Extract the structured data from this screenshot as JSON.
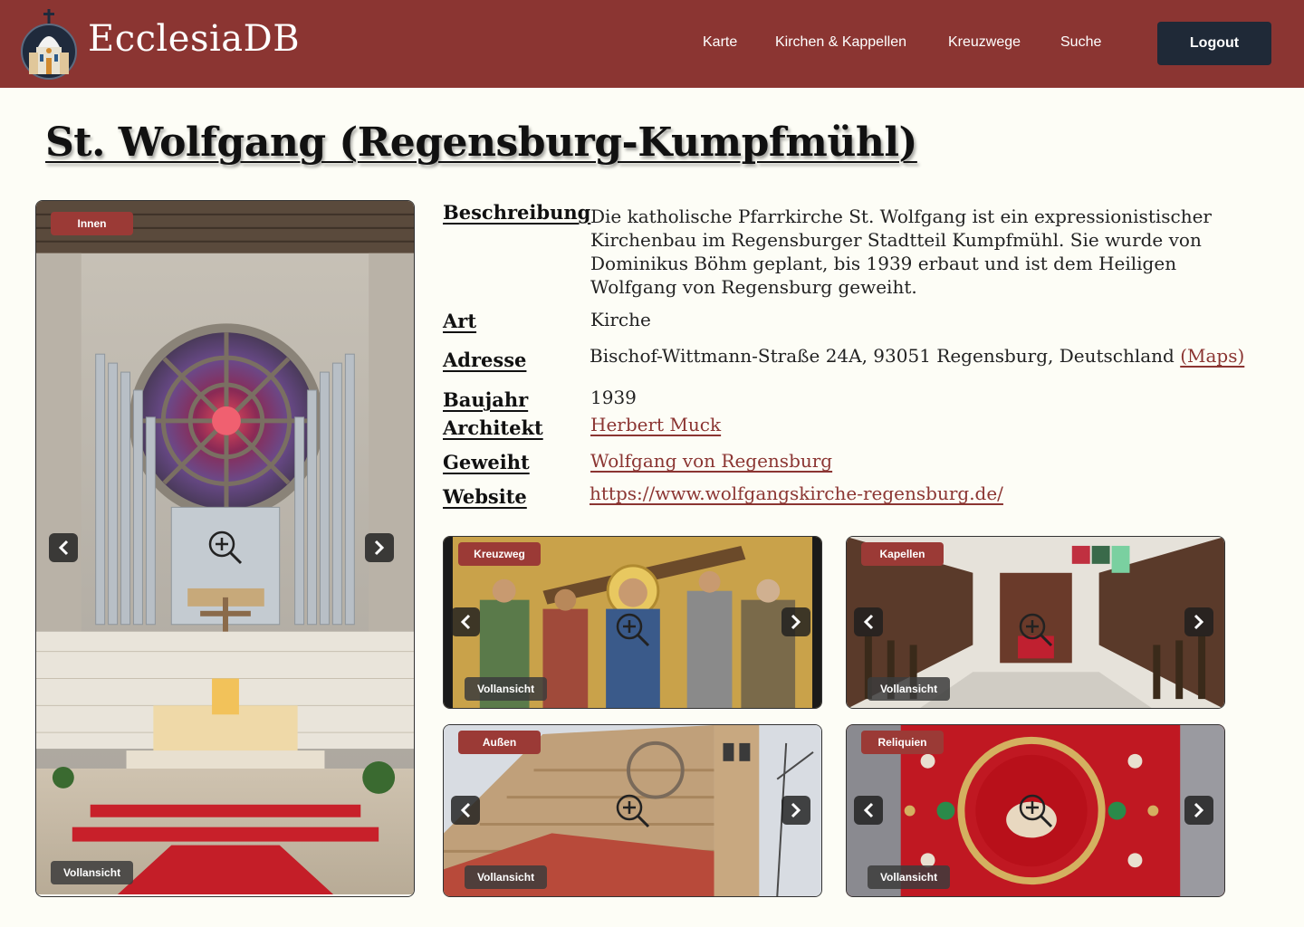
{
  "header": {
    "brand": "EcclesiaDB",
    "nav": [
      "Karte",
      "Kirchen & Kappellen",
      "Kreuzwege",
      "Suche"
    ],
    "logout_label": "Logout",
    "colors": {
      "header_bg": "#8b3532",
      "logout_bg": "#1f2937"
    }
  },
  "page": {
    "title": "St. Wolfgang (Regensburg-Kumpfmühl)"
  },
  "info": {
    "description_label": "Beschreibung",
    "description": "Die katholische Pfarrkirche St. Wolfgang ist ein expressionistischer Kirchenbau im Regensburger Stadtteil Kumpfmühl. Sie wurde von Dominikus Böhm geplant, bis 1939 erbaut und ist dem Heiligen Wolfgang von Regensburg geweiht.",
    "type_label": "Art",
    "type": "Kirche",
    "address_label": "Adresse",
    "address": "Bischof-Wittmann-Straße 24A, 93051 Regensburg, Deutschland",
    "maps_link": "(Maps)",
    "year_label": "Baujahr",
    "year": "1939",
    "architect_label": "Architekt",
    "architect": "Herbert Muck",
    "consecrated_label": "Geweiht",
    "consecrated": "Wolfgang von Regensburg",
    "website_label": "Website",
    "website": "https://www.wolfgangskirche-regensburg.de/"
  },
  "gallery": {
    "full_view_label": "Vollansicht",
    "main": {
      "badge": "Innen",
      "icon": "church-interior-image"
    },
    "cards": [
      {
        "badge": "Kreuzweg",
        "icon": "stations-of-cross-image"
      },
      {
        "badge": "Kapellen",
        "icon": "chapel-interior-image"
      },
      {
        "badge": "Außen",
        "icon": "church-exterior-image"
      },
      {
        "badge": "Reliquien",
        "icon": "relic-image"
      }
    ]
  }
}
